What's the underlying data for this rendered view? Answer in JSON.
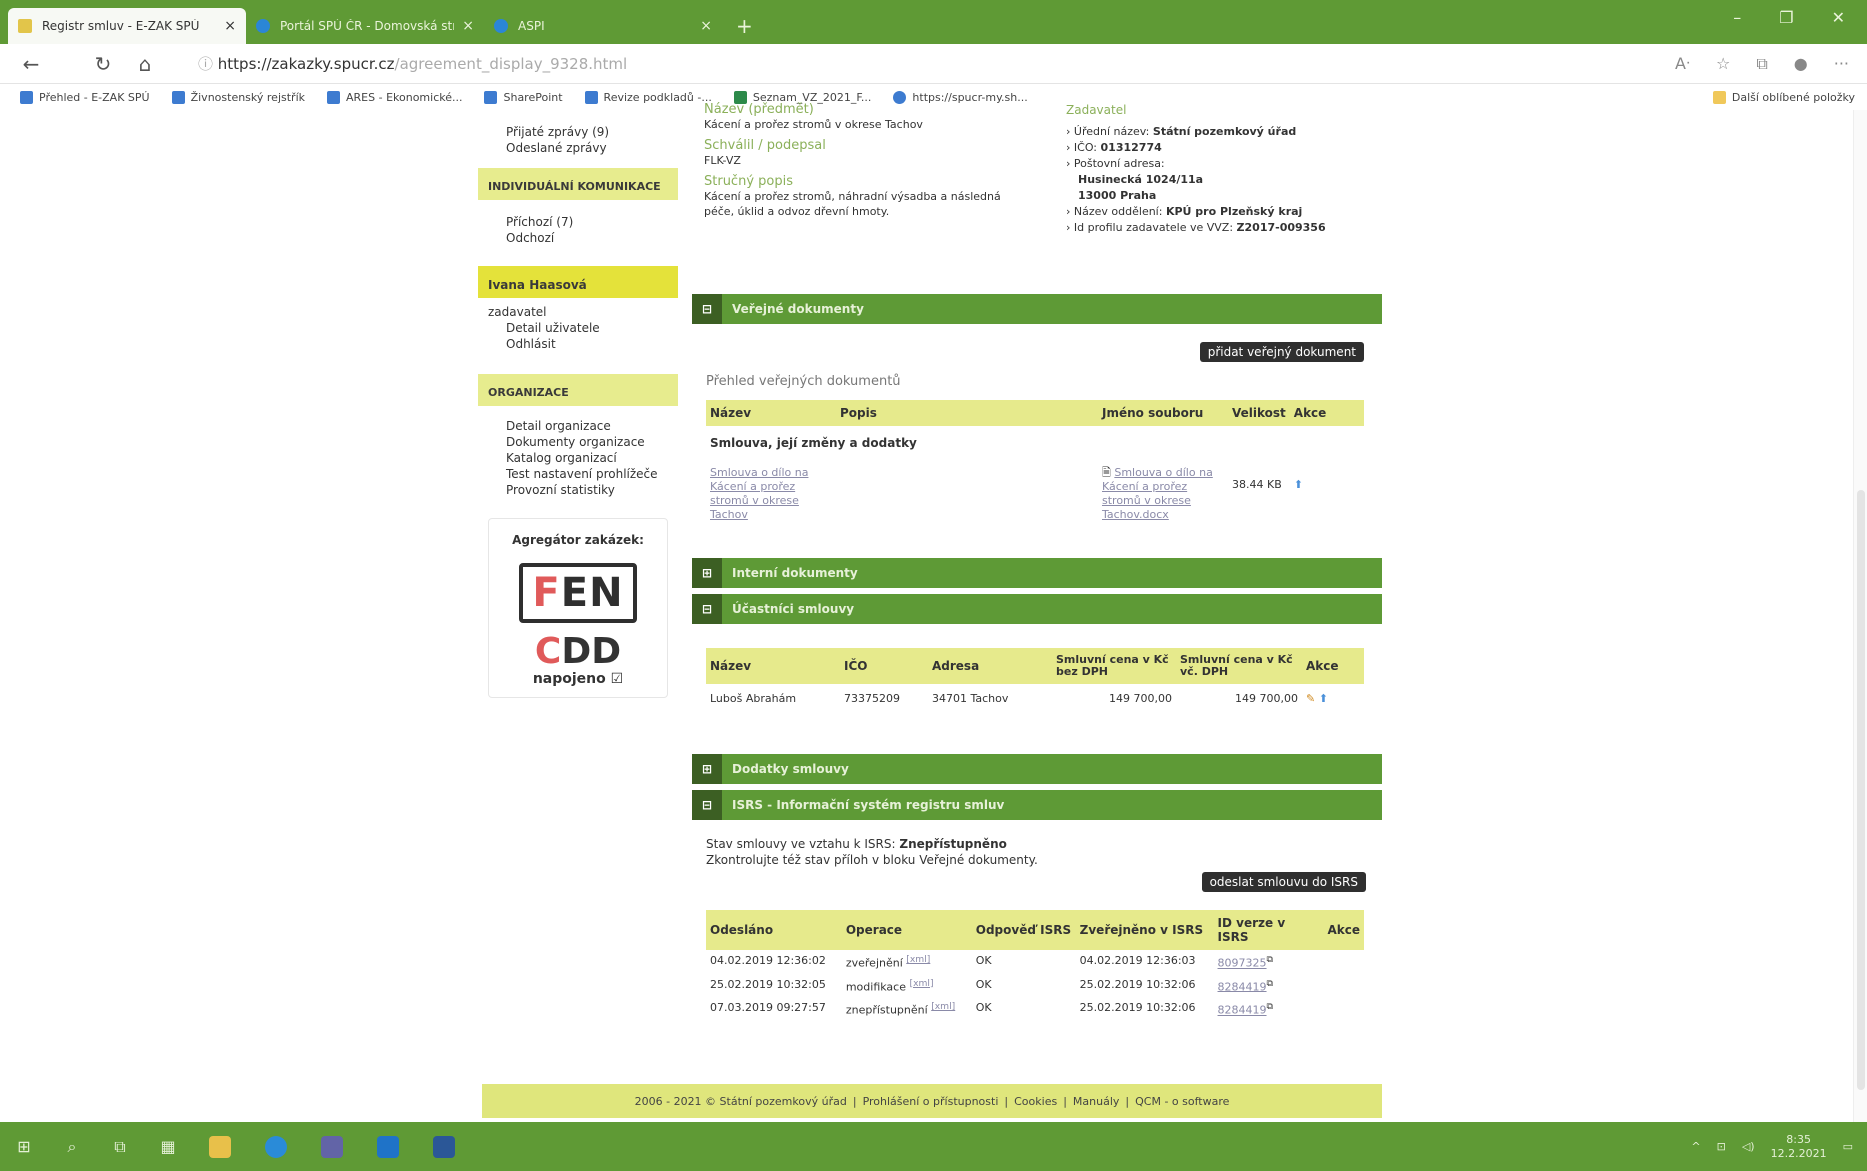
{
  "browser": {
    "tabs": [
      {
        "title": "Registr smluv - E-ZAK SPÚ",
        "active": true
      },
      {
        "title": "Portál SPÚ ČR - Domovská strán",
        "active": false
      },
      {
        "title": "ASPI",
        "active": false
      }
    ],
    "url_domain": "https://zakazky.spucr.cz",
    "url_path": "/agreement_display_9328.html",
    "bookmarks": [
      "Přehled - E-ZAK SPÚ",
      "Živnostenský rejstřík",
      "ARES - Ekonomické...",
      "SharePoint",
      "Revize podkladů -...",
      "Seznam_VZ_2021_F...",
      "https://spucr-my.sh..."
    ],
    "other_favorites": "Další oblíbené položky"
  },
  "sidebar": {
    "messages": [
      "Přijaté zprávy (9)",
      "Odeslané zprávy"
    ],
    "comm_header": "INDIVIDUÁLNÍ KOMUNIKACE",
    "comm_items": [
      "Příchozí (7)",
      "Odchozí"
    ],
    "user_name": "Ivana Haasová",
    "user_role": "zadavatel",
    "user_items": [
      "Detail uživatele",
      "Odhlásit"
    ],
    "org_header": "ORGANIZACE",
    "org_items": [
      "Detail organizace",
      "Dokumenty organizace",
      "Katalog organizací",
      "Test nastavení prohlížeče",
      "Provozní statistiky"
    ],
    "aggregator_title": "Agregátor zakázek:",
    "fen_f": "F",
    "fen_en": "EN",
    "cdd_c": "C",
    "cdd_dd": "DD",
    "cdd_sub": "napojeno"
  },
  "info": {
    "name_label": "Název (předmět)",
    "name_value": "Kácení a prořez stromů v okrese Tachov",
    "approved_label": "Schválil / podepsal",
    "approved_value": "FLK-VZ",
    "desc_label": "Stručný popis",
    "desc_value": "Kácení a prořez stromů, náhradní výsadba a následná péče, úklid a odvoz dřevní hmoty.",
    "authority_label": "Zadavatel",
    "official_name_label": "Úřední název:",
    "official_name": "Státní pozemkový úřad",
    "ico_label": "IČO:",
    "ico": "01312774",
    "address_label": "Poštovní adresa:",
    "address_street": "Husinecká 1024/11a",
    "address_city": "13000 Praha",
    "dept_label": "Název oddělení:",
    "dept": "KPÚ pro Plzeňský kraj",
    "profile_label": "Id profilu zadavatele ve VVZ:",
    "profile_id": "Z2017-009356"
  },
  "public_docs": {
    "section_title": "Veřejné dokumenty",
    "add_button": "přidat veřejný dokument",
    "overview_title": "Přehled veřejných dokumentů",
    "columns": [
      "Název",
      "Popis",
      "Jméno souboru",
      "Velikost",
      "Akce"
    ],
    "group": "Smlouva, její změny a dodatky",
    "row": {
      "name": "Smlouva o dílo na Kácení a prořez stromů v okrese Tachov",
      "file": "Smlouva o dílo na Kácení a prořez stromů v okrese Tachov.docx",
      "size": "38.44 KB"
    }
  },
  "internal_docs": {
    "section_title": "Interní dokumenty"
  },
  "participants": {
    "section_title": "Účastníci smlouvy",
    "columns": [
      "Název",
      "IČO",
      "Adresa",
      "Smluvní cena v Kč bez DPH",
      "Smluvní cena v Kč vč. DPH",
      "Akce"
    ],
    "row": {
      "name": "Luboš Abrahám",
      "ico": "73375209",
      "address": "34701 Tachov",
      "price_no_vat": "149 700,00",
      "price_vat": "149 700,00"
    }
  },
  "amendments": {
    "section_title": "Dodatky smlouvy"
  },
  "isrs": {
    "section_title": "ISRS - Informační systém registru smluv",
    "status_label": "Stav smlouvy ve vztahu k ISRS:",
    "status_value": "Znepřístupněno",
    "check_text": "Zkontrolujte též stav příloh v bloku Veřejné dokumenty.",
    "send_button": "odeslat smlouvu do ISRS",
    "columns": [
      "Odesláno",
      "Operace",
      "Odpověď ISRS",
      "Zveřejněno v ISRS",
      "ID verze v ISRS",
      "Akce"
    ],
    "rows": [
      {
        "sent": "04.02.2019 12:36:02",
        "op": "zveřejnění",
        "resp": "OK",
        "pub": "04.02.2019 12:36:03",
        "id": "8097325"
      },
      {
        "sent": "25.02.2019 10:32:05",
        "op": "modifikace",
        "resp": "OK",
        "pub": "25.02.2019 10:32:06",
        "id": "8284419"
      },
      {
        "sent": "07.03.2019 09:27:57",
        "op": "znepřístupnění",
        "resp": "OK",
        "pub": "25.02.2019 10:32:06",
        "id": "8284419"
      }
    ],
    "xml_tag": "[xml]"
  },
  "footer": {
    "items": [
      "2006 - 2021 © Státní pozemkový úřad",
      "Prohlášení o přístupnosti",
      "Cookies",
      "Manuály",
      "QCM - o software"
    ]
  },
  "taskbar": {
    "time": "8:35",
    "date": "12.2.2021"
  }
}
